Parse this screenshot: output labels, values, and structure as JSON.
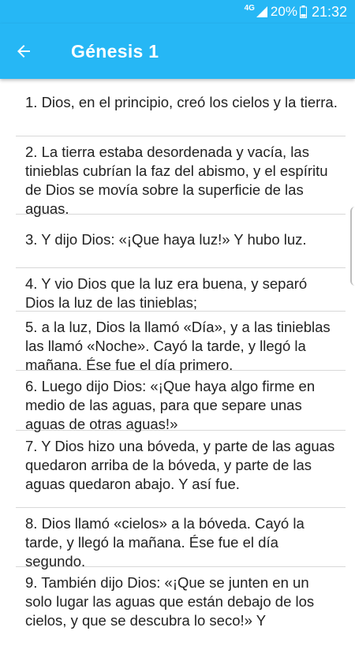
{
  "status_bar": {
    "network": "4G",
    "battery_percent": "20%",
    "time": "21:32"
  },
  "app_bar": {
    "title": "Génesis 1",
    "back_icon": "arrow-left-icon",
    "color": "#26b7f5"
  },
  "verses": [
    {
      "text": "1. Dios, en el principio, creó los cielos y la tierra."
    },
    {
      "text": "2. La tierra estaba desordenada y vacía, las tinieblas cubrían la faz del abismo, y el espíritu de Dios se movía sobre la superficie de las aguas."
    },
    {
      "text": "3. Y dijo Dios: «¡Que haya luz!» Y hubo luz."
    },
    {
      "text": "4. Y vio Dios que la luz era buena, y separó Dios la luz de las tinieblas;"
    },
    {
      "text": "5. a la luz, Dios la llamó «Día», y a las tinieblas las llamó «Noche». Cayó la tarde, y llegó la mañana. Ése fue el día primero."
    },
    {
      "text": "6. Luego dijo Dios: «¡Que haya algo firme en medio de las aguas, para que separe unas aguas de otras aguas!»"
    },
    {
      "text": "7. Y Dios hizo una bóveda, y parte de las aguas quedaron arriba de la bóveda, y parte de las aguas quedaron abajo. Y así fue."
    },
    {
      "text": "8. Dios llamó «cielos» a la bóveda. Cayó la tarde, y llegó la mañana. Ése fue el día segundo."
    },
    {
      "text": "9. También dijo Dios: «¡Que se junten en un solo lugar las aguas que están debajo de los cielos, y que se descubra lo seco!» Y"
    }
  ]
}
